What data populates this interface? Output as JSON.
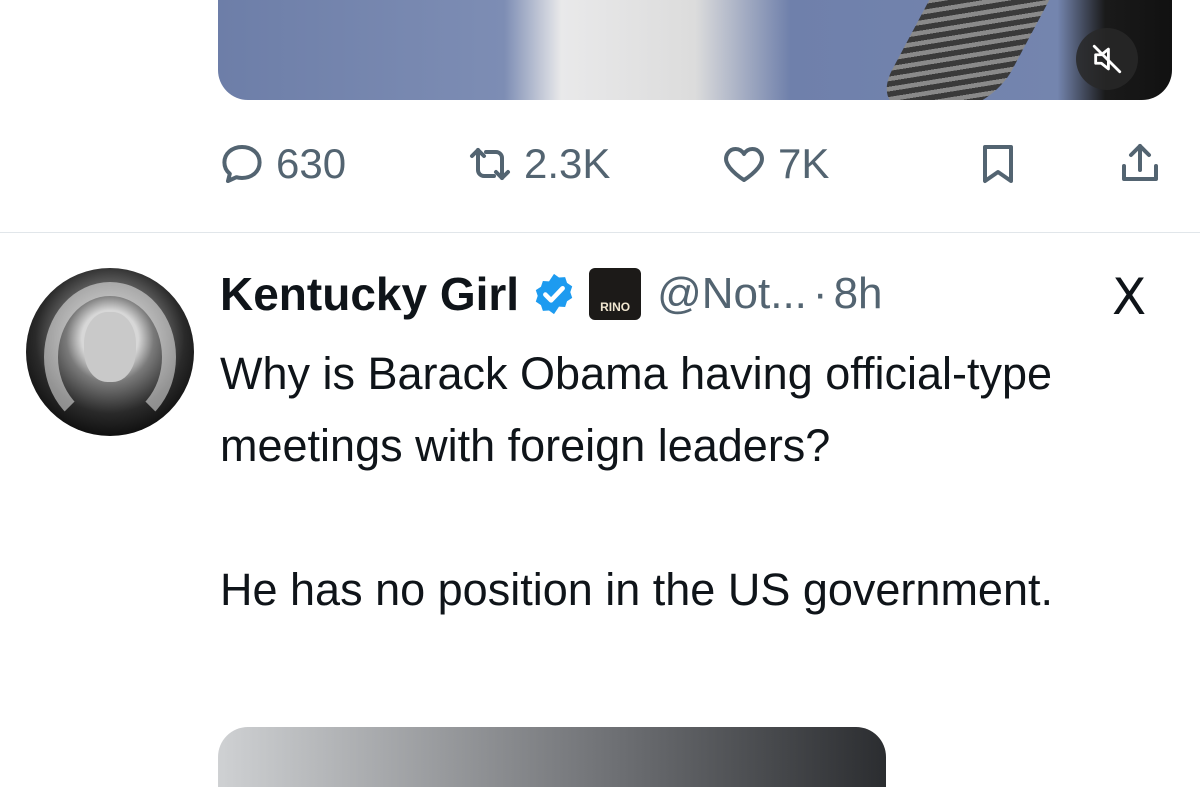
{
  "previous_post": {
    "actions": {
      "replies": "630",
      "reposts": "2.3K",
      "likes": "7K"
    },
    "icons": [
      "reply-icon",
      "repost-icon",
      "like-icon",
      "bookmark-icon",
      "share-icon",
      "mute-icon"
    ]
  },
  "post": {
    "display_name": "Kentucky Girl",
    "badge_text": "RINO",
    "handle": "@Not...",
    "separator": "·",
    "time": "8h",
    "platform_logo": "X",
    "paragraphs": [
      "Why is Barack Obama having official-type meetings with foreign leaders?",
      "He has no position in the US government."
    ]
  },
  "colors": {
    "text": "#0f1419",
    "muted": "#536471",
    "verified": "#1d9bf0",
    "divider": "#e1e6ea"
  }
}
